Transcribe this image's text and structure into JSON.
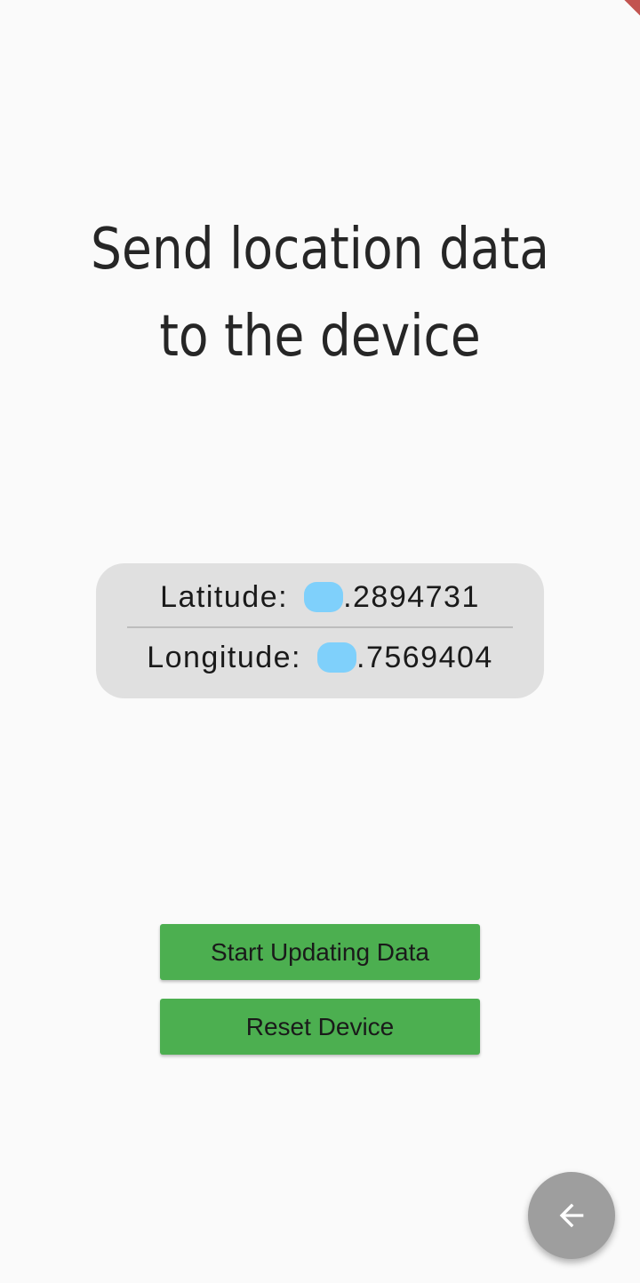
{
  "app": {
    "title_line1": "Send location data",
    "title_line2": "to the device"
  },
  "location": {
    "latitude_label": "Latitude:",
    "latitude_value": ".2894731",
    "longitude_label": "Longitude:",
    "longitude_value": ".7569404"
  },
  "actions": {
    "start_label": "Start Updating Data",
    "reset_label": "Reset Device"
  },
  "fab": {
    "icon": "arrow-back-icon"
  },
  "colors": {
    "background": "#fafafa",
    "card": "#e0e0e0",
    "button": "#4caf50",
    "fab": "#9e9e9e",
    "redaction": "#7fd0fb",
    "debug_banner": "#c25450"
  }
}
